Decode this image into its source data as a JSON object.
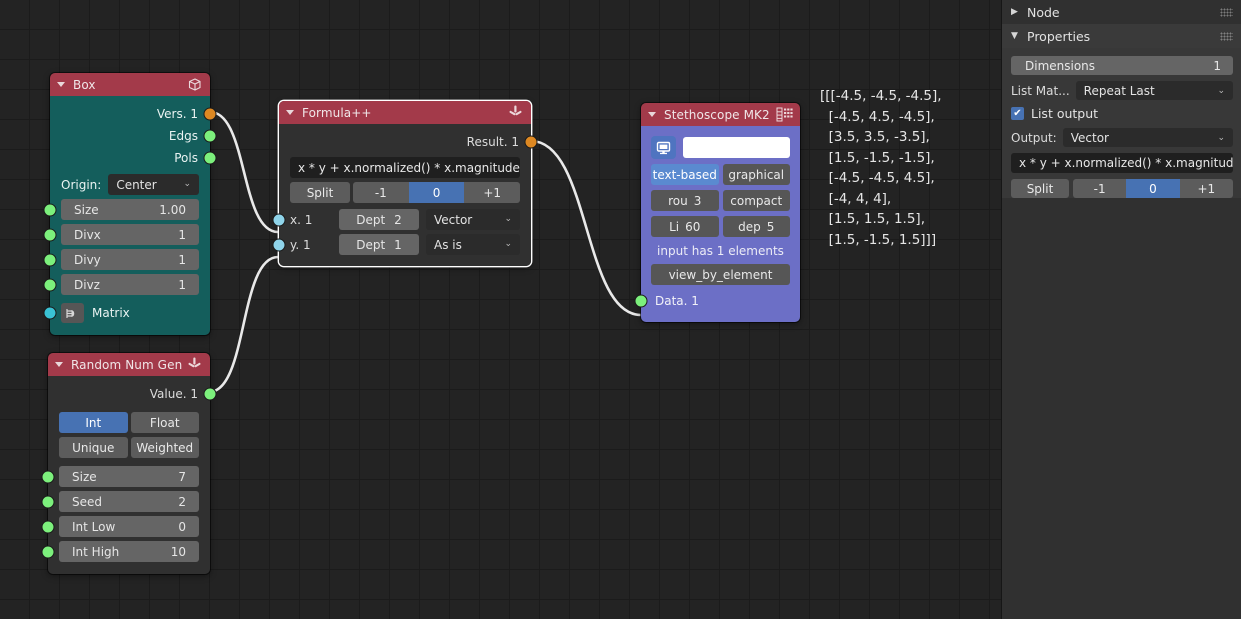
{
  "editor": {
    "background_color": "#232323",
    "grid_color": "#1b1b1b"
  },
  "nodes": {
    "box": {
      "title": "Box",
      "header_icon": "cube-icon",
      "header_color": "#a33a4a",
      "body_color": "#145e5c",
      "outputs": [
        {
          "label": "Vers. 1",
          "socket": "vertices-socket",
          "color": "#dd8822"
        },
        {
          "label": "Edgs",
          "socket": "edges-socket",
          "color": "#7cf07c"
        },
        {
          "label": "Pols",
          "socket": "polygons-socket",
          "color": "#7cf07c"
        }
      ],
      "origin_label": "Origin:",
      "origin_value": "Center",
      "params": [
        {
          "label": "Size",
          "value": "1.00",
          "socket_color": "#7cf07c"
        },
        {
          "label": "Divx",
          "value": "1",
          "socket_color": "#7cf07c"
        },
        {
          "label": "Divy",
          "value": "1",
          "socket_color": "#7cf07c"
        },
        {
          "label": "Divz",
          "value": "1",
          "socket_color": "#7cf07c"
        }
      ],
      "matrix_label": "Matrix",
      "matrix_socket_color": "#3ac2d4"
    },
    "formula": {
      "title": "Formula++",
      "header_icon": "script-icon",
      "header_color": "#a33a4a",
      "body_color": "#303030",
      "output": {
        "label": "Result. 1",
        "color": "#dd8822"
      },
      "formula": "x * y + x.normalized() * x.magnitude",
      "split_label": "Split",
      "steps": [
        "-1",
        "0",
        "+1"
      ],
      "active_step": "0",
      "inputs": [
        {
          "label": "x. 1",
          "depth_label": "Dept",
          "depth_value": "2",
          "mode": "Vector",
          "socket_color": "#8fd4ea"
        },
        {
          "label": "y. 1",
          "depth_label": "Dept",
          "depth_value": "1",
          "mode": "As is",
          "socket_color": "#8fd4ea"
        }
      ]
    },
    "stethoscope": {
      "title": "Stethoscope MK2",
      "header_icon": "spreadsheet-icon",
      "header_color": "#a33a4a",
      "body_color": "#6c6fc6",
      "monitor_icon": "monitor-icon",
      "color_field_value": "",
      "mode_buttons": [
        {
          "label": "text-based",
          "active": true
        },
        {
          "label": "graphical",
          "active": false
        }
      ],
      "round_label": "rou",
      "round_value": "3",
      "compact_label": "compact",
      "lines_label": "Li",
      "lines_value": "60",
      "depth_label": "dep",
      "depth_value": "5",
      "info_text": "input has 1 elements",
      "view_button": "view_by_element",
      "input": {
        "label": "Data. 1",
        "color": "#7cf07c"
      }
    },
    "random": {
      "title": "Random Num Gen",
      "header_icon": "script-icon",
      "header_color": "#a33a4a",
      "body_color": "#303030",
      "output": {
        "label": "Value. 1",
        "color": "#7cf07c"
      },
      "type_buttons": [
        {
          "label": "Int",
          "active": true
        },
        {
          "label": "Float",
          "active": false
        }
      ],
      "mode_buttons": [
        {
          "label": "Unique",
          "active": false
        },
        {
          "label": "Weighted",
          "active": false
        }
      ],
      "params": [
        {
          "label": "Size",
          "value": "7",
          "socket_color": "#7cf07c"
        },
        {
          "label": "Seed",
          "value": "2",
          "socket_color": "#7cf07c"
        },
        {
          "label": "Int Low",
          "value": "0",
          "socket_color": "#7cf07c"
        },
        {
          "label": "Int High",
          "value": "10",
          "socket_color": "#7cf07c"
        }
      ]
    }
  },
  "data_output": {
    "text": "[[[-4.5, -4.5, -4.5],\n  [-4.5, 4.5, -4.5],\n  [3.5, 3.5, -3.5],\n  [1.5, -1.5, -1.5],\n  [-4.5, -4.5, 4.5],\n  [-4, 4, 4],\n  [1.5, 1.5, 1.5],\n  [1.5, -1.5, 1.5]]]"
  },
  "sidebar": {
    "node_panel": {
      "title": "Node",
      "expanded": false
    },
    "properties_panel": {
      "title": "Properties",
      "expanded": true
    },
    "dimensions": {
      "label": "Dimensions",
      "value": "1"
    },
    "list_match": {
      "label": "List Mat...",
      "value": "Repeat Last"
    },
    "list_output": {
      "label": "List output",
      "checked": true,
      "check_glyph": "✔"
    },
    "output": {
      "label": "Output:",
      "value": "Vector"
    },
    "formula": "x * y + x.normalized() * x.magnitude",
    "split_label": "Split",
    "steps": [
      "-1",
      "0",
      "+1"
    ],
    "active_step": "0"
  }
}
